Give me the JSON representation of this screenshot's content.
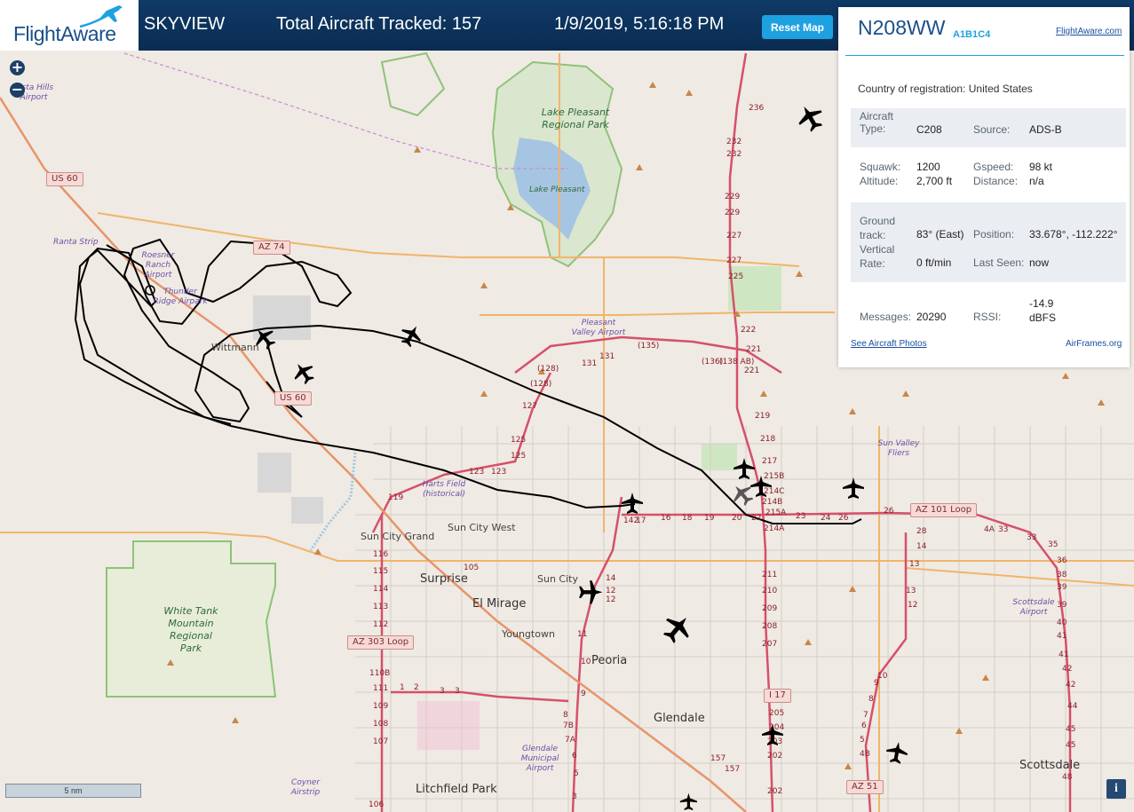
{
  "header": {
    "logo_text": "FlightAware",
    "product": "SKYVIEW",
    "tracked": "Total Aircraft Tracked: 157",
    "datetime": "1/9/2019, 5:16:18 PM",
    "reset_label": "Reset Map"
  },
  "colors": {
    "header_bg": "#0a2c52",
    "accent": "#1ea1e1",
    "brand": "#1b4f8a",
    "track": "#000000",
    "highway": "#d6506b",
    "arterial": "#f1b46a"
  },
  "map": {
    "zoom_in": "+",
    "zoom_out": "−",
    "scale_label": "5 nm",
    "info_label": "i",
    "places": [
      {
        "name": "Wittmann"
      },
      {
        "name": "Sun City Grand"
      },
      {
        "name": "Sun City West"
      },
      {
        "name": "Surprise"
      },
      {
        "name": "El Mirage"
      },
      {
        "name": "Sun City"
      },
      {
        "name": "Youngtown"
      },
      {
        "name": "Peoria"
      },
      {
        "name": "Glendale"
      },
      {
        "name": "Litchfield Park"
      },
      {
        "name": "Scottsdale"
      }
    ],
    "parks": [
      {
        "name": "Lake Pleasant Regional Park"
      },
      {
        "name": "Lake Pleasant"
      },
      {
        "name": "White Tank Mountain Regional Park"
      }
    ],
    "airports": [
      {
        "name": "Buckeye Vista Hills Airport",
        "text": "Vista Hills Airport"
      },
      {
        "name": "Ranta Strip"
      },
      {
        "name": "Roesner Ranch Airport"
      },
      {
        "name": "Thunder Ridge Airpark",
        "text": "Thunder Ridge Airpark"
      },
      {
        "name": "Pleasant Valley Airport"
      },
      {
        "name": "Harts Field (historical)"
      },
      {
        "name": "Sun Valley Fliers"
      },
      {
        "name": "Scottsdale Airport"
      },
      {
        "name": "Glendale Municipal Airport"
      },
      {
        "name": "Coyner Airstrip"
      }
    ],
    "shields": [
      "US 60",
      "AZ 74",
      "US 60",
      "AZ 101 Loop",
      "AZ 303 Loop",
      "I 17",
      "AZ 51"
    ],
    "route_numbers": [
      "236",
      "232",
      "232",
      "229",
      "229",
      "227",
      "227",
      "225",
      "222",
      "221",
      "221",
      "219",
      "218",
      "217",
      "215B",
      "214C",
      "214B",
      "215A",
      "214A",
      "211",
      "210",
      "209",
      "208",
      "207",
      "205",
      "204",
      "203",
      "202",
      "202",
      "(135)",
      "(128)",
      "(128)",
      "131",
      "131",
      "127",
      "125",
      "125",
      "123",
      "123",
      "119",
      "116",
      "115",
      "114",
      "113",
      "112",
      "110B",
      "111",
      "109",
      "108",
      "107",
      "106",
      "105",
      "142",
      "17",
      "16",
      "18",
      "19",
      "20",
      "22",
      "23",
      "24",
      "26",
      "26",
      "28",
      "14",
      "13",
      "13",
      "12",
      "12",
      "11",
      "10",
      "9",
      "8",
      "7B",
      "7A",
      "6",
      "5",
      "3",
      "1",
      "2",
      "3",
      "3",
      "14",
      "12",
      "10",
      "9",
      "8",
      "7",
      "6",
      "5",
      "4B",
      "4A",
      "33",
      "33",
      "35",
      "36",
      "38",
      "39",
      "39",
      "40",
      "41",
      "41",
      "42",
      "42",
      "44",
      "45",
      "45",
      "48",
      "157",
      "157",
      "(136)",
      "(138 AB)"
    ]
  },
  "panel": {
    "registration": "N208WW",
    "hex": "A1B1C4",
    "fa_link": "FlightAware.com",
    "country_label": "Country of registration:",
    "country": "United States",
    "aircraft_type_label": "Aircraft Type:",
    "aircraft_type": "C208",
    "source_label": "Source:",
    "source": "ADS-B",
    "squawk_label": "Squawk:",
    "squawk": "1200",
    "gspeed_label": "Gspeed:",
    "gspeed": "98 kt",
    "altitude_label": "Altitude:",
    "altitude": "2,700 ft",
    "distance_label": "Distance:",
    "distance": "n/a",
    "ground_track_label": "Ground track:",
    "ground_track": "83° (East)",
    "position_label": "Position:",
    "position": "33.678°, -112.222°",
    "vertical_rate_label": "Vertical Rate:",
    "vertical_rate": "0 ft/min",
    "last_seen_label": "Last Seen:",
    "last_seen": "now",
    "messages_label": "Messages:",
    "messages": "20290",
    "rssi_label": "RSSI:",
    "rssi": "-14.9 dBFS",
    "photos_link": "See Aircraft Photos",
    "airframes_link": "AirFrames.org"
  }
}
